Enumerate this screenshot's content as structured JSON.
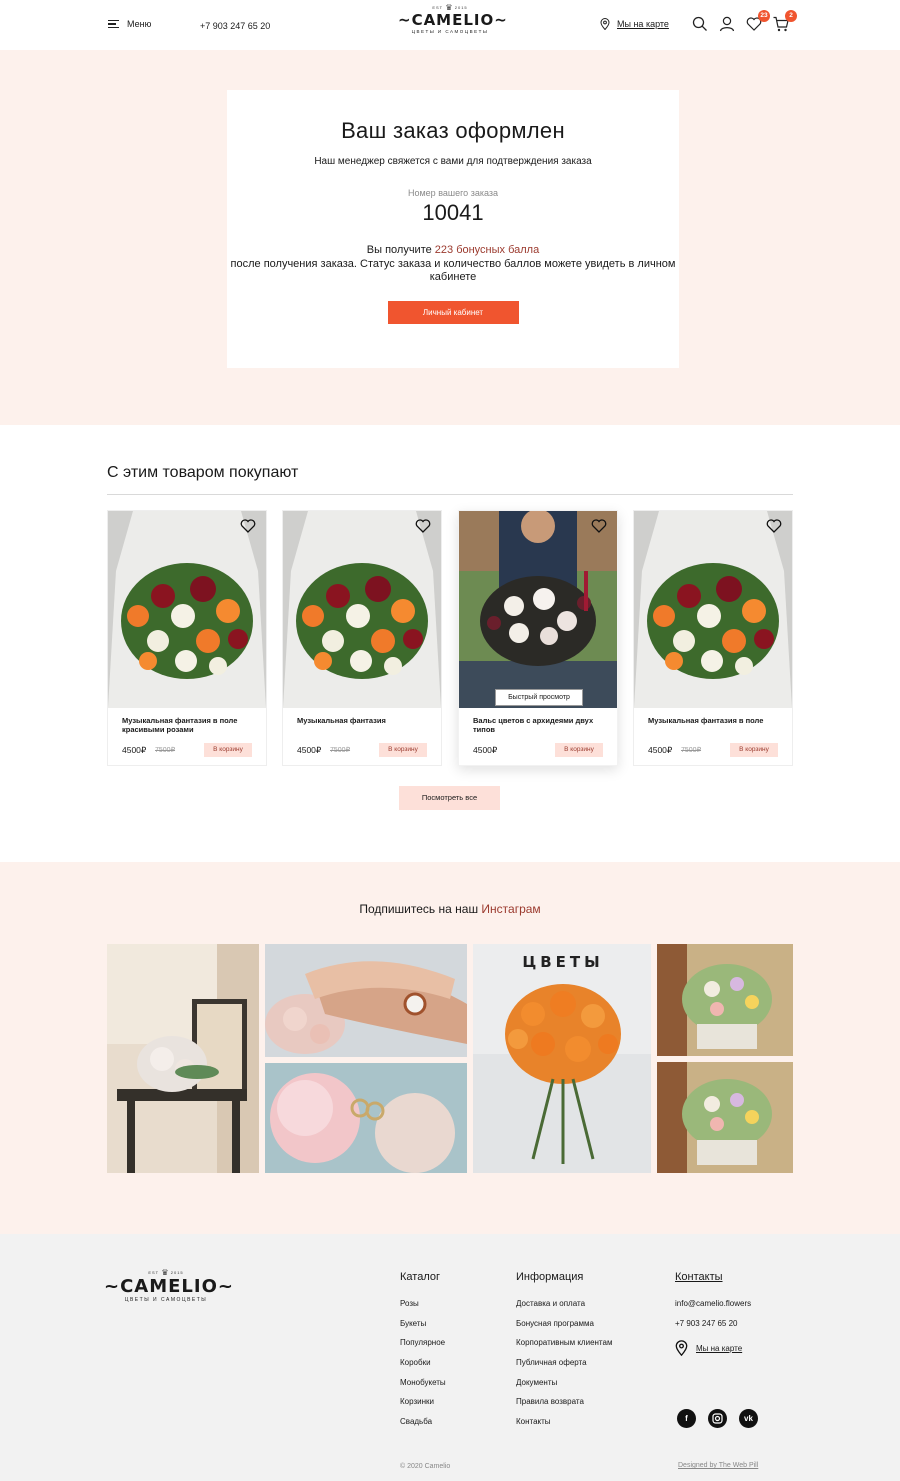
{
  "header": {
    "menu_label": "Меню",
    "phone": "+7 903 247 65 20",
    "logo": {
      "name": "~CAMELIO~",
      "est_left": "EST",
      "est_right": "2015",
      "tagline": "ЦВЕТЫ И САМОЦВЕТЫ"
    },
    "map_label": "Мы на карте",
    "favorites_count": "23",
    "cart_count": "2"
  },
  "confirmation": {
    "title": "Ваш заказ оформлен",
    "subtitle": "Наш менеджер свяжется с вами для подтверждения заказа",
    "order_label": "Номер вашего заказа",
    "order_number": "10041",
    "bonus_before": "Вы получите ",
    "bonus_highlight": "223 бонусных балла",
    "bonus_after": " после получения заказа. Статус заказа и количество баллов можете увидеть в личном кабинете",
    "cabinet_button": "Личный кабинет"
  },
  "related": {
    "title": "С этим товаром покупают",
    "quick_view": "Быстрый просмотр",
    "add_to_cart": "В корзину",
    "view_all": "Посмотреть все",
    "products": [
      {
        "name": "Музыкальная фантазия в поле красивыми розами",
        "price": "4500₽",
        "old_price": "7500₽"
      },
      {
        "name": "Музыкальная фантазия",
        "price": "4500₽",
        "old_price": "7500₽"
      },
      {
        "name": "Вальс цветов с архидеями двух типов",
        "price": "4500₽",
        "old_price": ""
      },
      {
        "name": "Музыкальная фантазия в поле",
        "price": "4500₽",
        "old_price": "7500₽"
      }
    ]
  },
  "instagram": {
    "title_before": "Подпишитесь на наш ",
    "title_link": "Инстаграм",
    "photo_sign_text": "ЦВЕТЫ"
  },
  "footer": {
    "catalog": {
      "title": "Каталог",
      "items": [
        "Розы",
        "Букеты",
        "Популярное",
        "Коробки",
        "Монобукеты",
        "Корзинки",
        "Свадьба"
      ]
    },
    "info": {
      "title": "Информация",
      "items": [
        "Доставка и оплата",
        "Бонусная программа",
        "Корпоративным клиентам",
        "Публичная оферта",
        "Документы",
        "Правила возврата",
        "Контакты"
      ]
    },
    "contacts": {
      "title": "Контакты",
      "email": "info@camelio.flowers",
      "phone": "+7 903 247 65 20",
      "map": "Мы на карте"
    },
    "socials": [
      "facebook-icon",
      "instagram-icon",
      "vk-icon"
    ],
    "copyright": "© 2020 Camelio",
    "designed_by": "Designed by The Web Pill"
  },
  "colors": {
    "accent": "#f0552f",
    "accent_dark": "#9b3a2e",
    "hero_bg": "#fdf1ec",
    "button_light": "#fde0d9",
    "footer_bg": "#f2f2f2"
  }
}
